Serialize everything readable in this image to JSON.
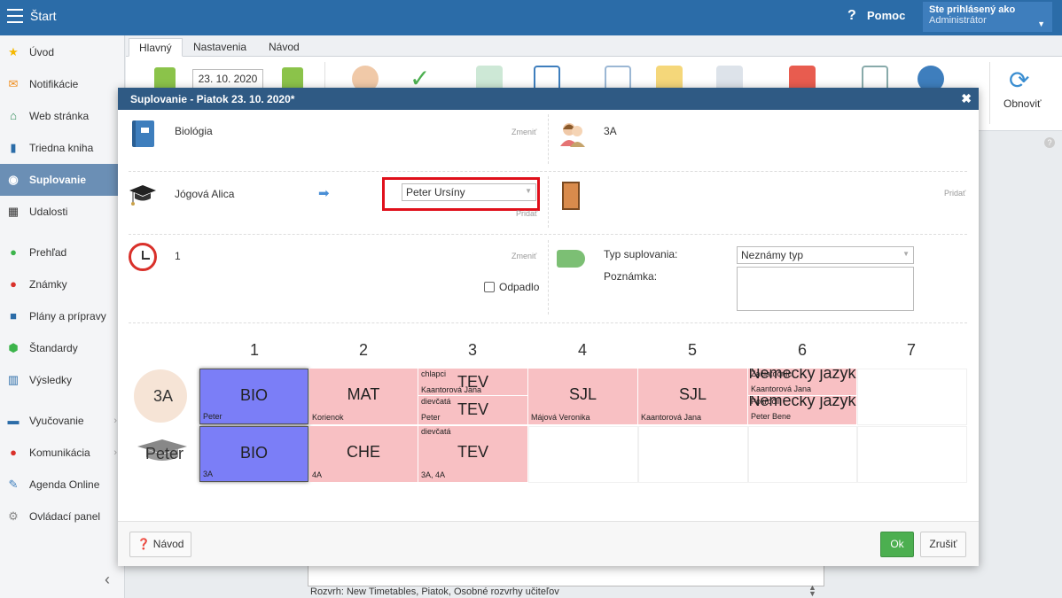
{
  "topbar": {
    "title": "Štart",
    "help": "Pomoc",
    "user_line1": "Ste prihlásený ako",
    "user_line2": "Administrátor"
  },
  "sidebar": {
    "items": [
      {
        "label": "Úvod",
        "icon": "star-icon"
      },
      {
        "label": "Notifikácie",
        "icon": "mail-icon"
      },
      {
        "label": "Web stránka",
        "icon": "home-icon"
      },
      {
        "label": "Triedna kniha",
        "icon": "book-icon"
      },
      {
        "label": "Suplovanie",
        "icon": "user-icon"
      },
      {
        "label": "Udalosti",
        "icon": "calendar-icon"
      },
      {
        "label": "Prehľad",
        "icon": "check-circle-icon"
      },
      {
        "label": "Známky",
        "icon": "grades-icon"
      },
      {
        "label": "Plány a prípravy",
        "icon": "briefcase-icon"
      },
      {
        "label": "Štandardy",
        "icon": "shield-icon"
      },
      {
        "label": "Výsledky",
        "icon": "bar-chart-icon"
      },
      {
        "label": "Vyučovanie",
        "icon": "board-icon"
      },
      {
        "label": "Komunikácia",
        "icon": "chat-icon"
      },
      {
        "label": "Agenda Online",
        "icon": "pen-icon"
      },
      {
        "label": "Ovládací panel",
        "icon": "gear-icon"
      }
    ]
  },
  "tabs": [
    "Hlavný",
    "Nastavenia",
    "Návod"
  ],
  "ribbon": {
    "date": "23. 10. 2020",
    "refresh": "Obnoviť"
  },
  "status": {
    "text": "Rozvrh: New Timetables, Piatok, Osobné rozvrhy učiteľov"
  },
  "dialog": {
    "title": "Suplovanie - Piatok 23. 10. 2020*",
    "subject": "Biológia",
    "change1": "Zmeniť",
    "class": "3A",
    "teacher": "Jógová Alica",
    "substitute": "Peter Ursíny",
    "add1": "Pridať",
    "add2": "Pridať",
    "lesson": "1",
    "change2": "Zmeniť",
    "cancelled_label": "Odpadlo",
    "type_label": "Typ suplovania:",
    "type_value": "Neznámy typ",
    "note_label": "Poznámka:",
    "help_button": "Návod",
    "ok_button": "Ok",
    "cancel_button": "Zrušiť"
  },
  "grid": {
    "periods": [
      "1",
      "2",
      "3",
      "4",
      "5",
      "6",
      "7"
    ],
    "row_labels": [
      "3A",
      "Peter"
    ],
    "row1": {
      "p1": {
        "subject": "BIO",
        "teacher": "Peter"
      },
      "p2": {
        "subject": "MAT",
        "teacher": "Korienok"
      },
      "p3a": {
        "subject": "TEV",
        "group": "chlapci",
        "teacher": "Kaantorová Jana"
      },
      "p3b": {
        "subject": "TEV",
        "group": "dievčatá",
        "teacher": "Peter"
      },
      "p4": {
        "subject": "SJL",
        "teacher": "Májová Veronika"
      },
      "p5": {
        "subject": "SJL",
        "teacher": "Kaantorová Jana"
      },
      "p6a": {
        "subject": "Nemecký jazyk",
        "group": "Začiatočníci",
        "teacher": "Kaantorová Jana"
      },
      "p6b": {
        "subject": "Nemecký jazyk",
        "group": "Pokročilí",
        "teacher": "Peter Bene"
      }
    },
    "row2": {
      "p1": {
        "subject": "BIO",
        "class": "3A"
      },
      "p2": {
        "subject": "CHE",
        "class": "4A"
      },
      "p3": {
        "subject": "TEV",
        "group": "dievčatá",
        "class": "3A, 4A"
      }
    }
  }
}
